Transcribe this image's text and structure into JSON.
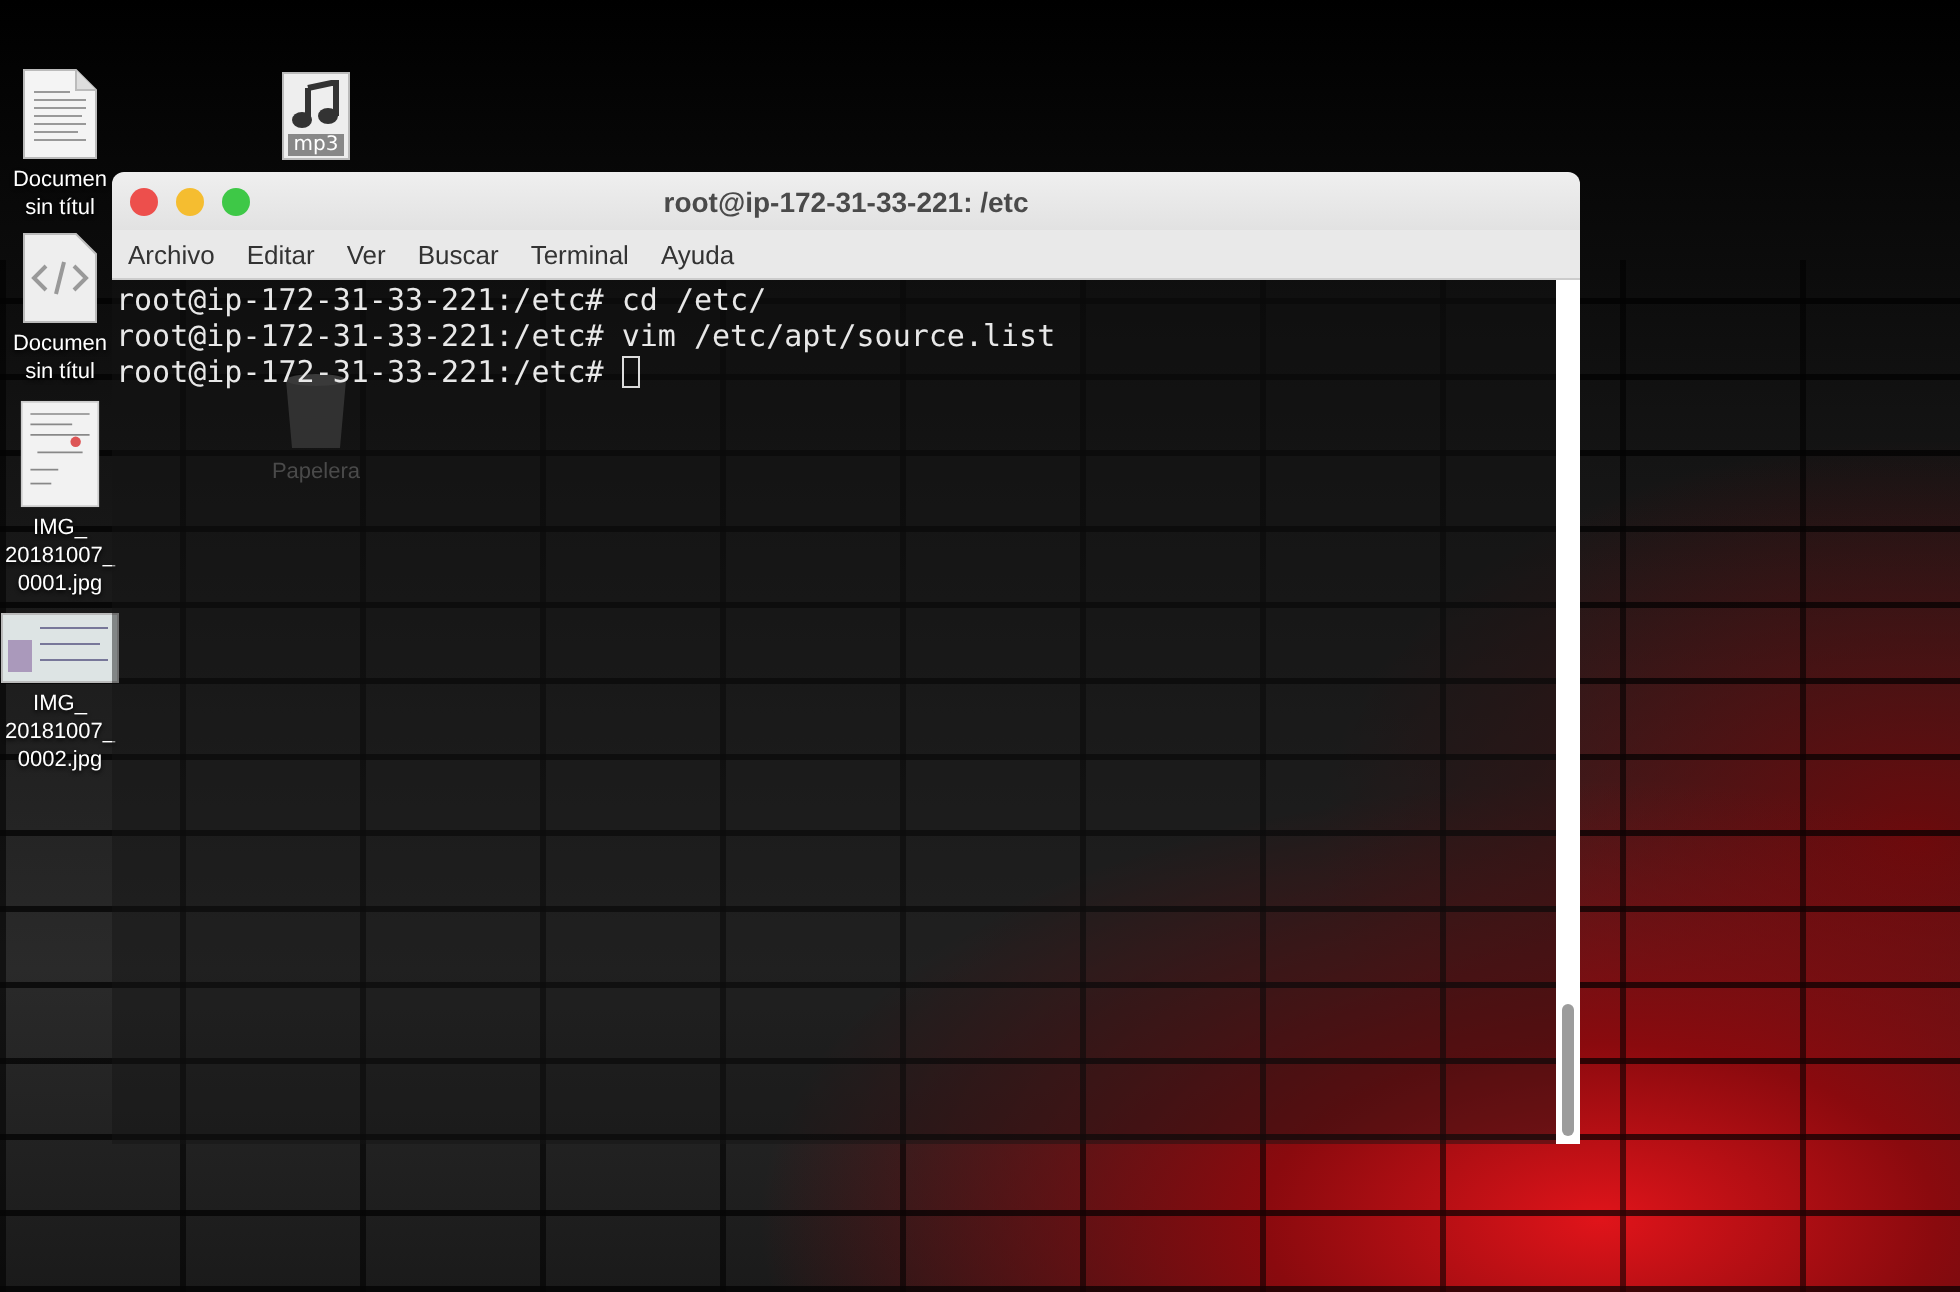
{
  "desktop_icons": [
    {
      "kind": "document",
      "label_lines": [
        "Documen",
        "sin títul"
      ]
    },
    {
      "kind": "audio",
      "badge": "mp3"
    },
    {
      "kind": "code",
      "label_lines": [
        "Documen",
        "sin títul"
      ]
    },
    {
      "kind": "scan",
      "label_lines": [
        "IMG_",
        "20181007_",
        "0001.jpg"
      ]
    },
    {
      "kind": "photo",
      "label_lines": [
        "IMG_",
        "20181007_",
        "0002.jpg"
      ]
    },
    {
      "kind": "trash",
      "label_lines": [
        "Papelera"
      ]
    }
  ],
  "terminal": {
    "title": "root@ip-172-31-33-221: /etc",
    "menu": [
      "Archivo",
      "Editar",
      "Ver",
      "Buscar",
      "Terminal",
      "Ayuda"
    ],
    "lines": [
      {
        "prompt": "root@ip-172-31-33-221:/etc#",
        "command": "cd /etc/",
        "cursor": false
      },
      {
        "prompt": "root@ip-172-31-33-221:/etc#",
        "command": "vim /etc/apt/source.list",
        "cursor": false
      },
      {
        "prompt": "root@ip-172-31-33-221:/etc#",
        "cursor": true
      }
    ]
  }
}
